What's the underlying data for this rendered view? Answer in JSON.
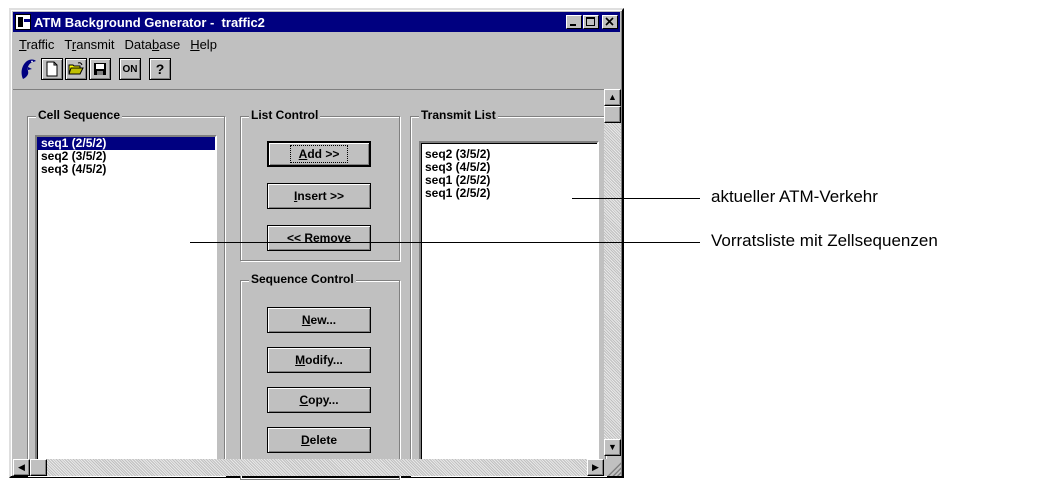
{
  "window": {
    "title": "ATM Background Generator -  traffic2",
    "controls": [
      "minimize-icon",
      "maximize-icon",
      "close-icon"
    ]
  },
  "menu": [
    {
      "pre": "",
      "u": "T",
      "post": "raffic"
    },
    {
      "pre": "T",
      "u": "r",
      "post": "ansmit"
    },
    {
      "pre": "Data",
      "u": "b",
      "post": "ase"
    },
    {
      "pre": "",
      "u": "H",
      "post": "elp"
    }
  ],
  "toolbar": {
    "on_label": "ON",
    "help_label": "?",
    "icons": [
      "dolphin-logo-icon",
      "new-file-icon",
      "open-folder-icon",
      "save-disk-icon",
      "on-icon",
      "help-icon"
    ]
  },
  "cell_sequence": {
    "label": "Cell Sequence",
    "items": [
      "seq1 (2/5/2)",
      "seq2 (3/5/2)",
      "seq3 (4/5/2)"
    ],
    "selected_index": 0
  },
  "list_control": {
    "label": "List Control",
    "add": {
      "u": "A",
      "post": "dd >>"
    },
    "insert": {
      "u": "I",
      "post": "nsert >>"
    },
    "remove": "<< Remove"
  },
  "sequence_control": {
    "label": "Sequence Control",
    "new": {
      "u": "N",
      "post": "ew..."
    },
    "modify": {
      "u": "M",
      "post": "odify..."
    },
    "copy": {
      "u": "C",
      "post": "opy..."
    },
    "delete": {
      "u": "D",
      "post": "elete"
    }
  },
  "transmit_list": {
    "label": "Transmit List",
    "items": [
      "seq2 (3/5/2)",
      "seq3 (4/5/2)",
      "seq1 (2/5/2)",
      "seq1 (2/5/2)"
    ]
  },
  "annotations": {
    "top": "aktueller ATM-Verkehr",
    "bottom": "Vorratsliste mit Zellsequenzen"
  }
}
